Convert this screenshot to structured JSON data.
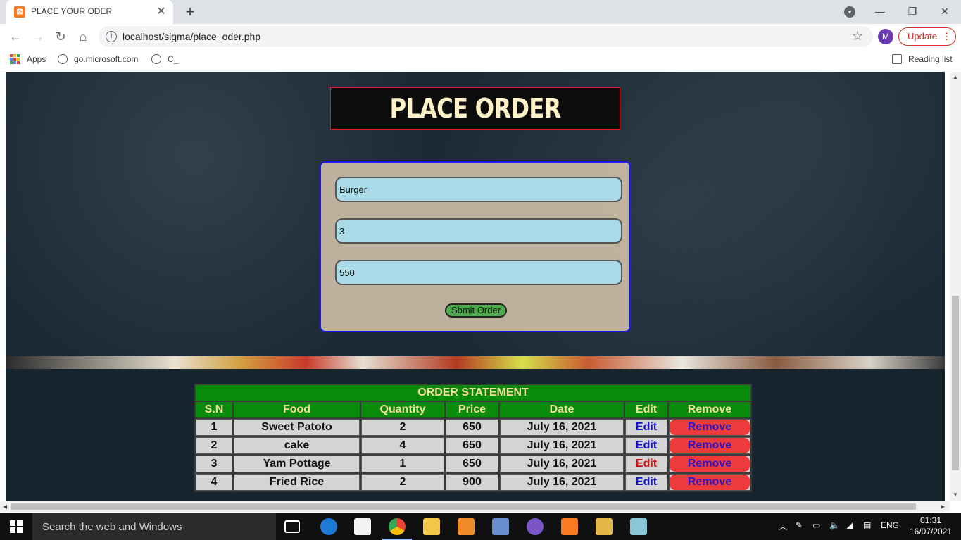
{
  "browser": {
    "tab_title": "PLACE YOUR ODER",
    "url": "localhost/sigma/place_oder.php",
    "profile_initial": "M",
    "update_label": "Update",
    "bookmarks": [
      "Apps",
      "go.microsoft.com",
      "C_"
    ],
    "reading_list": "Reading list"
  },
  "page": {
    "title": "PLACE ORDER",
    "form": {
      "food_value": "Burger",
      "quantity_value": "3",
      "price_value": "550",
      "submit_label": "Sbmit Order"
    },
    "table": {
      "caption": "ORDER STATEMENT",
      "headers": [
        "S.N",
        "Food",
        "Quantity",
        "Price",
        "Date",
        "Edit",
        "Remove"
      ],
      "rows": [
        {
          "sn": "1",
          "food": "Sweet Patoto",
          "quantity": "2",
          "price": "650",
          "date": "July 16, 2021",
          "edit": "Edit",
          "remove": "Remove"
        },
        {
          "sn": "2",
          "food": "cake",
          "quantity": "4",
          "price": "650",
          "date": "July 16, 2021",
          "edit": "Edit",
          "remove": "Remove"
        },
        {
          "sn": "3",
          "food": "Yam Pottage",
          "quantity": "1",
          "price": "650",
          "date": "July 16, 2021",
          "edit": "Edit",
          "remove": "Remove"
        },
        {
          "sn": "4",
          "food": "Fried Rice",
          "quantity": "2",
          "price": "900",
          "date": "July 16, 2021",
          "edit": "Edit",
          "remove": "Remove"
        }
      ]
    }
  },
  "taskbar": {
    "search_placeholder": "Search the web and Windows",
    "language": "ENG",
    "time": "01:31",
    "date": "16/07/2021"
  },
  "colors": {
    "title_border": "#e02020",
    "form_border": "#1a1aee",
    "table_header_bg": "#0a8a0a",
    "remove_bg": "#ee3a3a",
    "submit_bg": "#4caa4c"
  }
}
